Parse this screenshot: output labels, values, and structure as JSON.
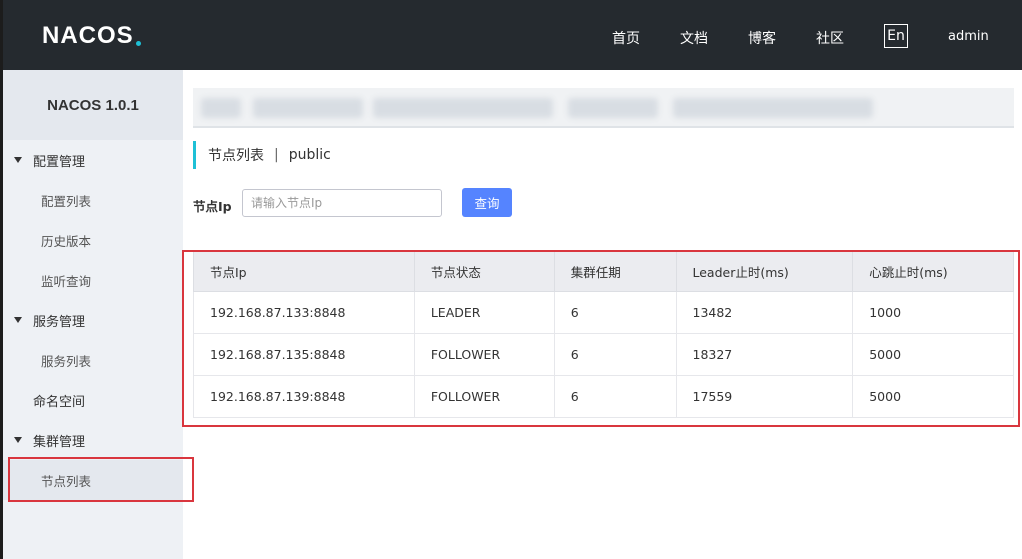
{
  "header": {
    "logo_text": "NACOS",
    "nav": [
      "首页",
      "文档",
      "博客",
      "社区"
    ],
    "lang": "En",
    "user": "admin"
  },
  "sidebar": {
    "title": "NACOS 1.0.1",
    "groups": [
      {
        "label": "配置管理",
        "items": [
          "配置列表",
          "历史版本",
          "监听查询"
        ]
      },
      {
        "label": "服务管理",
        "items": [
          "服务列表"
        ]
      },
      {
        "label": "命名空间"
      },
      {
        "label": "集群管理",
        "items": [
          "节点列表"
        ]
      }
    ]
  },
  "main": {
    "title": "节点列表",
    "separator": "|",
    "namespace": "public",
    "filter": {
      "label": "节点Ip",
      "placeholder": "请输入节点Ip",
      "button": "查询"
    },
    "table": {
      "columns": [
        "节点Ip",
        "节点状态",
        "集群任期",
        "Leader止时(ms)",
        "心跳止时(ms)"
      ],
      "rows": [
        [
          "192.168.87.133:8848",
          "LEADER",
          "6",
          "13482",
          "1000"
        ],
        [
          "192.168.87.135:8848",
          "FOLLOWER",
          "6",
          "18327",
          "5000"
        ],
        [
          "192.168.87.139:8848",
          "FOLLOWER",
          "6",
          "17559",
          "5000"
        ]
      ]
    }
  },
  "colors": {
    "header_bg": "#252a2f",
    "sidebar_bg": "#eef1f5",
    "accent": "#1ec0d6",
    "primary_button": "#5584ff",
    "highlight": "#d9363e"
  }
}
